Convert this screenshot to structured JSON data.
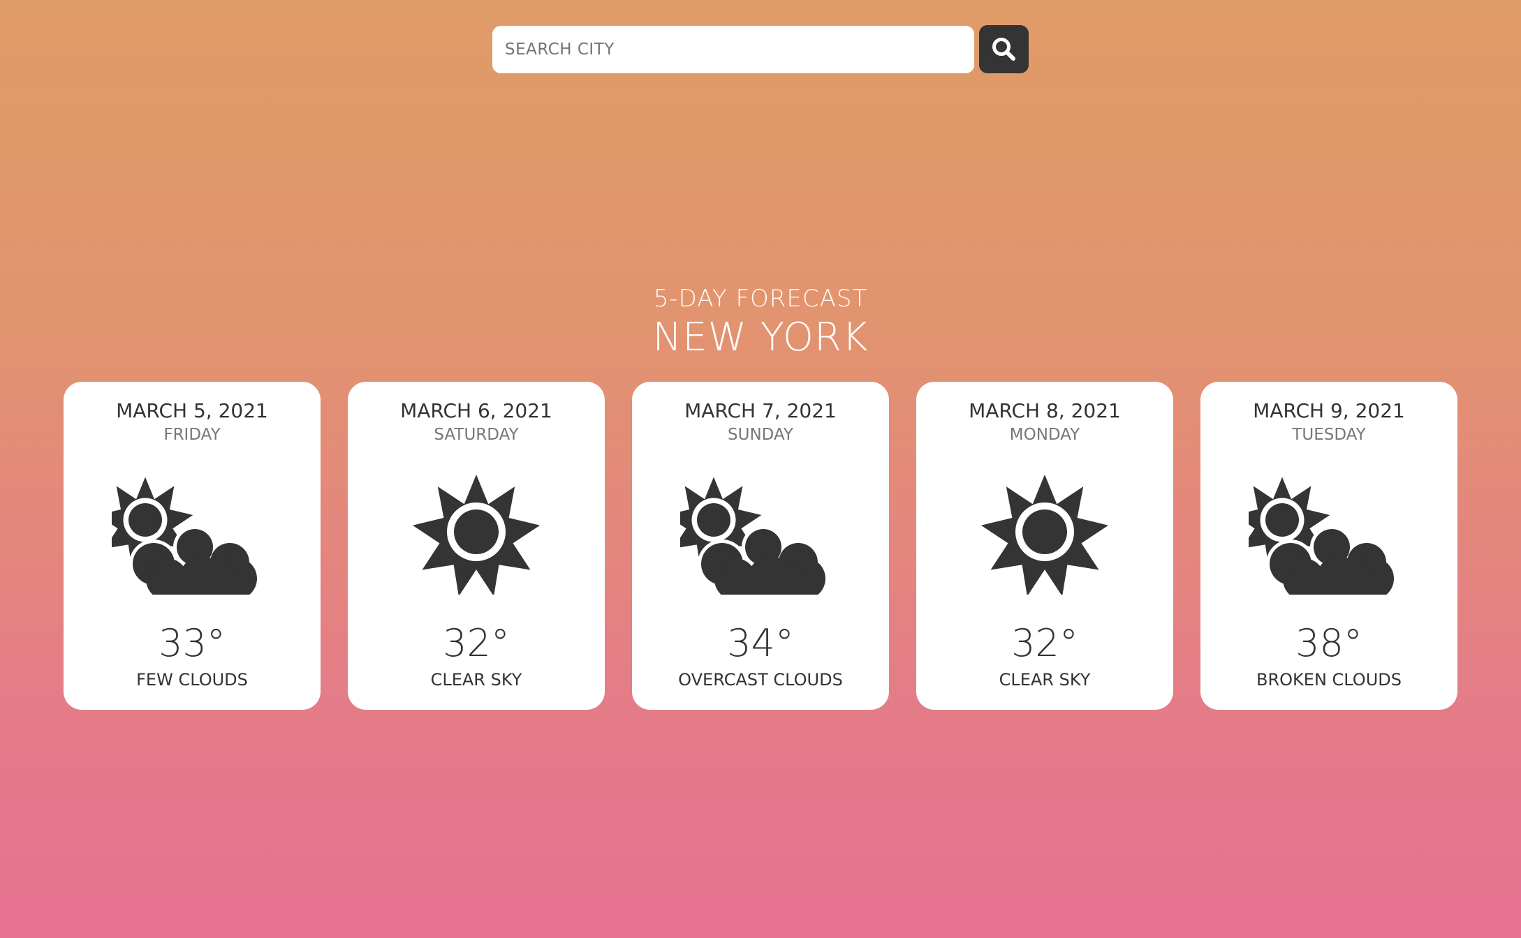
{
  "search": {
    "placeholder": "SEARCH CITY",
    "value": ""
  },
  "icons": {
    "search_button": "search-icon",
    "few_clouds": "sun-behind-cloud-icon",
    "clear_sky": "sun-icon"
  },
  "colors": {
    "gradient_top": "#e09c68",
    "gradient_bottom": "#e77093",
    "icon_dark": "#343434",
    "card_background": "#ffffff"
  },
  "forecast": {
    "subtitle": "5-DAY FORECAST",
    "city": "NEW YORK",
    "days": [
      {
        "date": "MARCH 5, 2021",
        "weekday": "FRIDAY",
        "temperature": "33°",
        "condition": "FEW CLOUDS",
        "icon": "sun-behind-cloud-icon"
      },
      {
        "date": "MARCH 6, 2021",
        "weekday": "SATURDAY",
        "temperature": "32°",
        "condition": "CLEAR SKY",
        "icon": "sun-icon"
      },
      {
        "date": "MARCH 7, 2021",
        "weekday": "SUNDAY",
        "temperature": "34°",
        "condition": "OVERCAST CLOUDS",
        "icon": "sun-behind-cloud-icon"
      },
      {
        "date": "MARCH 8, 2021",
        "weekday": "MONDAY",
        "temperature": "32°",
        "condition": "CLEAR SKY",
        "icon": "sun-icon"
      },
      {
        "date": "MARCH 9, 2021",
        "weekday": "TUESDAY",
        "temperature": "38°",
        "condition": "BROKEN CLOUDS",
        "icon": "sun-behind-cloud-icon"
      }
    ]
  }
}
